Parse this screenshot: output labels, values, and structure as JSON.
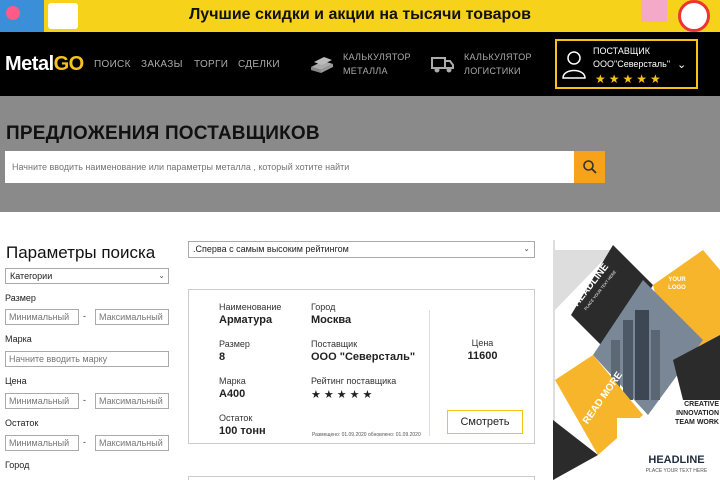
{
  "promo": {
    "text": "Лучшие скидки и акции на тысячи товаров"
  },
  "nav": {
    "logo_main": "Metal",
    "logo_accent": "GO",
    "links": [
      "ПОИСК",
      "ЗАКАЗЫ",
      "ТОРГИ",
      "СДЕЛКИ"
    ],
    "calc_metal": [
      "КАЛЬКУЛЯТОР",
      "МЕТАЛЛА"
    ],
    "calc_logistics": [
      "КАЛЬКУЛЯТОР",
      "ЛОГИСТИКИ"
    ],
    "supplier": {
      "role": "ПОСТАВЩИК",
      "name": "ООО\"Северсталь\"",
      "rating": 5,
      "stars": "★★★★★"
    }
  },
  "hero": {
    "title": "ПРЕДЛОЖЕНИЯ ПОСТАВЩИКОВ",
    "search_placeholder": "Начните вводить наименование или параметры металла , который хотите найти"
  },
  "sidebar": {
    "title": "Параметры поиска",
    "category_value": "Категории",
    "size_label": "Размер",
    "brand_label": "Марка",
    "brand_placeholder": "Начните вводить марку",
    "price_label": "Цена",
    "remainder_label": "Остаток",
    "city_label": "Город",
    "min_placeholder": "Минимальный",
    "max_placeholder": "Максимальный",
    "dash": "-"
  },
  "sort": {
    "value": ".Сперва с самым высоким рейтингом"
  },
  "offer": {
    "name_label": "Наименование",
    "name": "Арматура",
    "city_label": "Город",
    "city": "Москва",
    "size_label": "Размер",
    "size": "8",
    "supplier_label": "Поставщик",
    "supplier": "ООО \"Северсталь\"",
    "brand_label": "Марка",
    "brand": "А400",
    "rating_label": "Рейтинг поставщика",
    "rating": 5,
    "stars": "★★★★★",
    "stock_label": "Остаток",
    "stock": "100 тонн",
    "price_label": "Цена",
    "price": "11600",
    "dates": "Размещено: 01.09.2020 обновлено: 01.09.2020",
    "view_button": "Смотреть"
  },
  "ad": {
    "headline_diag": "HEADLINE",
    "headline_diag_sub": "PLACE YOUR TEXT HERE",
    "your_logo": "YOUR LOGO",
    "read_more": "READ MORE",
    "tagline": [
      "CREATIVE",
      "INNOVATION",
      "TEAM WORK"
    ],
    "headline_main": "HEADLINE",
    "headline_main_accent": "LINE",
    "headline_sub": "PLACE YOUR TEXT HERE",
    "colors": {
      "yellow": "#f7b52b",
      "dark": "#2b2b2b"
    }
  },
  "colors": {
    "accent": "#f7c21a",
    "nav_bg": "#000000",
    "hero_bg": "#8a8a8a"
  }
}
